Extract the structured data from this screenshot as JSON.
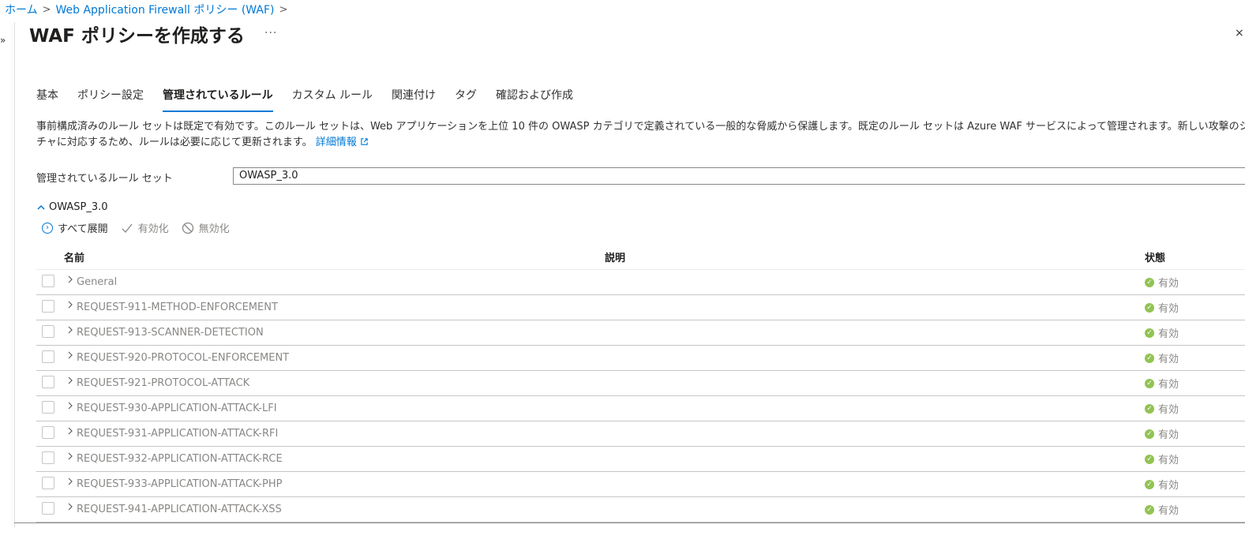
{
  "breadcrumb": {
    "home": "ホーム",
    "parent": "Web Application Firewall ポリシー (WAF)",
    "sep": ">"
  },
  "header": {
    "title": "WAF ポリシーを作成する",
    "more": "···",
    "collapse": "»",
    "close": "×"
  },
  "tabs": [
    {
      "label": "基本",
      "active": false
    },
    {
      "label": "ポリシー設定",
      "active": false
    },
    {
      "label": "管理されているルール",
      "active": true
    },
    {
      "label": "カスタム ルール",
      "active": false
    },
    {
      "label": "関連付け",
      "active": false
    },
    {
      "label": "タグ",
      "active": false
    },
    {
      "label": "確認および作成",
      "active": false
    }
  ],
  "description": {
    "line1": "事前構成済みのルール セットは既定で有効です。このルール セットは、Web アプリケーションを上位 10 件の OWASP カテゴリで定義されている一般的な脅威から保護します。既定のルール セットは Azure WAF サービスによって管理されます。新しい攻撃のシグ",
    "line2": "チャに対応するため、ルールは必要に応じて更新されます。",
    "link": "詳細情報"
  },
  "ruleset": {
    "label": "管理されているルール セット",
    "value": "OWASP_3.0"
  },
  "group": {
    "label": "OWASP_3.0"
  },
  "toolbar": {
    "expand_all": "すべて展開",
    "enable": "有効化",
    "disable": "無効化"
  },
  "table": {
    "columns": {
      "name": "名前",
      "description": "説明",
      "status": "状態"
    },
    "rows": [
      {
        "name": "General",
        "status": "有効"
      },
      {
        "name": "REQUEST-911-METHOD-ENFORCEMENT",
        "status": "有効"
      },
      {
        "name": "REQUEST-913-SCANNER-DETECTION",
        "status": "有効"
      },
      {
        "name": "REQUEST-920-PROTOCOL-ENFORCEMENT",
        "status": "有効"
      },
      {
        "name": "REQUEST-921-PROTOCOL-ATTACK",
        "status": "有効"
      },
      {
        "name": "REQUEST-930-APPLICATION-ATTACK-LFI",
        "status": "有効"
      },
      {
        "name": "REQUEST-931-APPLICATION-ATTACK-RFI",
        "status": "有効"
      },
      {
        "name": "REQUEST-932-APPLICATION-ATTACK-RCE",
        "status": "有効"
      },
      {
        "name": "REQUEST-933-APPLICATION-ATTACK-PHP",
        "status": "有効"
      },
      {
        "name": "REQUEST-941-APPLICATION-ATTACK-XSS",
        "status": "有効"
      }
    ]
  },
  "colors": {
    "accent": "#0078d4",
    "success": "#92c353"
  }
}
